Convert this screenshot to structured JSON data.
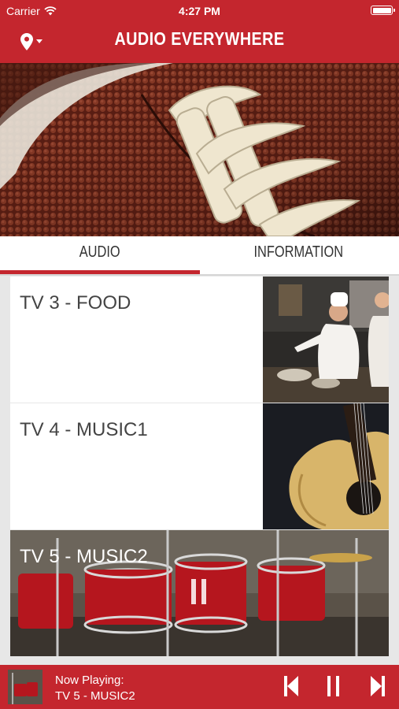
{
  "status": {
    "carrier": "Carrier",
    "time": "4:27 PM"
  },
  "header": {
    "title": "AUDIO EVERYWHERE"
  },
  "tabs": [
    {
      "label": "AUDIO"
    },
    {
      "label": "INFORMATION"
    }
  ],
  "channels": [
    {
      "label": "TV 3 - FOOD",
      "thumb": "chef-image"
    },
    {
      "label": "TV 4 - MUSIC1",
      "thumb": "guitar-image"
    },
    {
      "label": "TV 5 - MUSIC2",
      "thumb": "drums-image"
    }
  ],
  "player": {
    "now_playing_label": "Now Playing:",
    "track": "TV 5 - MUSIC2"
  },
  "colors": {
    "accent": "#c4262e",
    "background": "#e7e7e7"
  }
}
